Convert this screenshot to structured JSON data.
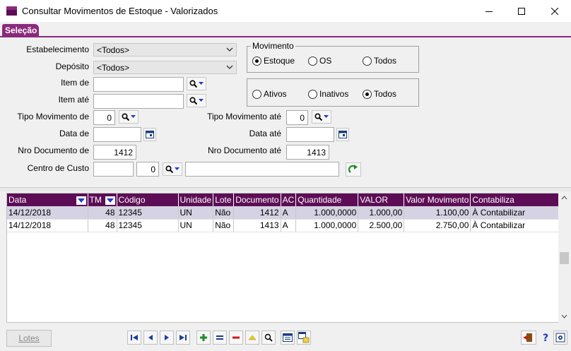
{
  "window": {
    "title": "Consultar Movimentos de Estoque - Valorizados",
    "controls": {
      "minimize": "minimize-icon",
      "maximize": "maximize-icon",
      "close": "close-icon"
    }
  },
  "tab": {
    "label": "Seleção"
  },
  "form": {
    "estabelecimento_label": "Estabelecimento",
    "estabelecimento_value": "<Todos>",
    "deposito_label": "Depósito",
    "deposito_value": "<Todos>",
    "item_de_label": "Item de",
    "item_de_value": "",
    "item_ate_label": "Item até",
    "item_ate_value": "",
    "tipo_mov_de_label": "Tipo Movimento de",
    "tipo_mov_de_value": "0",
    "tipo_mov_ate_label": "Tipo Movimento até",
    "tipo_mov_ate_value": "0",
    "data_de_label": "Data de",
    "data_de_value": "",
    "data_ate_label": "Data até",
    "data_ate_value": "",
    "nro_doc_de_label": "Nro Documento de",
    "nro_doc_de_value": "1412",
    "nro_doc_ate_label": "Nro Documento até",
    "nro_doc_ate_value": "1413",
    "centro_custo_label": "Centro de Custo",
    "centro_custo_code": "",
    "centro_custo_num": "0",
    "centro_custo_desc": ""
  },
  "movimento": {
    "legend": "Movimento",
    "options": [
      {
        "label": "Estoque",
        "checked": true
      },
      {
        "label": "OS",
        "checked": false
      },
      {
        "label": "Todos",
        "checked": false
      }
    ]
  },
  "status": {
    "options": [
      {
        "label": "Ativos",
        "checked": false
      },
      {
        "label": "Inativos",
        "checked": false
      },
      {
        "label": "Todos",
        "checked": true
      }
    ]
  },
  "grid": {
    "columns": [
      "Data",
      "TM",
      "Código",
      "Unidade",
      "Lote",
      "Documento",
      "AC",
      "Quantidade",
      "VALOR",
      "Valor Movimento",
      "Contabiliza"
    ],
    "rows": [
      [
        "14/12/2018",
        "48",
        "12345",
        "UN",
        "Não",
        "1412",
        "A",
        "1.000,0000",
        "1.000,00",
        "1.100,00",
        "À Contabilizar"
      ],
      [
        "14/12/2018",
        "48",
        "12345",
        "UN",
        "Não",
        "1413",
        "A",
        "1.000,0000",
        "2.500,00",
        "2.750,00",
        "À Contabilizar"
      ]
    ]
  },
  "bottom": {
    "lotes_label": "Lotes"
  },
  "colors": {
    "accent": "#8a2a7c",
    "header": "#5c0d55",
    "selected_row": "#d5d3e3"
  }
}
